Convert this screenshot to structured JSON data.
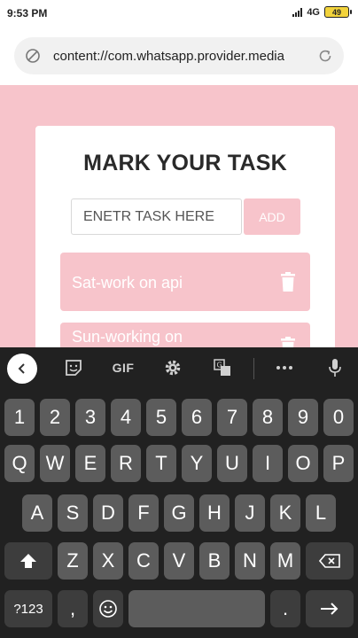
{
  "status_bar": {
    "time": "9:53 PM",
    "network": "4G",
    "battery": "49"
  },
  "browser": {
    "url": "content://com.whatsapp.provider.media"
  },
  "app": {
    "title": "MARK YOUR TASK",
    "input_placeholder": "ENETR TASK HERE",
    "add_label": "ADD",
    "tasks": [
      {
        "text": "Sat-work on api"
      },
      {
        "text": "Sun-working on"
      }
    ]
  },
  "keyboard": {
    "toolbar": {
      "gif_label": "GIF"
    },
    "row1": [
      "1",
      "2",
      "3",
      "4",
      "5",
      "6",
      "7",
      "8",
      "9",
      "0"
    ],
    "row2": [
      "Q",
      "W",
      "E",
      "R",
      "T",
      "Y",
      "U",
      "I",
      "O",
      "P"
    ],
    "row3": [
      "A",
      "S",
      "D",
      "F",
      "G",
      "H",
      "J",
      "K",
      "L"
    ],
    "row4": [
      "Z",
      "X",
      "C",
      "V",
      "B",
      "N",
      "M"
    ],
    "row5": {
      "symbols_label": "?123",
      "comma": ",",
      "period": "."
    }
  },
  "colors": {
    "accent_pink": "#f7c4cb",
    "keyboard_bg": "#212121",
    "key_bg": "#5c5c5c"
  }
}
